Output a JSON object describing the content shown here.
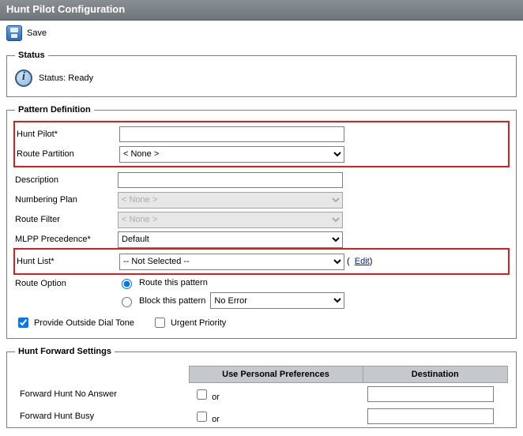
{
  "title": "Hunt Pilot Configuration",
  "toolbar": {
    "save_label": "Save"
  },
  "status": {
    "legend": "Status",
    "text": "Status: Ready"
  },
  "pattern": {
    "legend": "Pattern Definition",
    "hunt_pilot_label": "Hunt Pilot",
    "hunt_pilot_value": "",
    "route_partition_label": "Route Partition",
    "route_partition_value": "< None >",
    "description_label": "Description",
    "description_value": "",
    "numbering_plan_label": "Numbering Plan",
    "numbering_plan_value": "< None >",
    "route_filter_label": "Route Filter",
    "route_filter_value": "< None >",
    "mlpp_label": "MLPP Precedence",
    "mlpp_value": "Default",
    "hunt_list_label": "Hunt List",
    "hunt_list_value": "-- Not Selected --",
    "edit_label": "Edit",
    "route_option_label": "Route Option",
    "route_this_label": "Route this pattern",
    "block_this_label": "Block this pattern",
    "block_reason_value": "No Error",
    "provide_tone_label": "Provide Outside Dial Tone",
    "urgent_priority_label": "Urgent Priority"
  },
  "forward": {
    "legend": "Hunt Forward Settings",
    "col_pref": "Use Personal Preferences",
    "col_dest": "Destination",
    "row1_label": "Forward Hunt No Answer",
    "row2_label": "Forward Hunt Busy",
    "or_label": "or"
  }
}
